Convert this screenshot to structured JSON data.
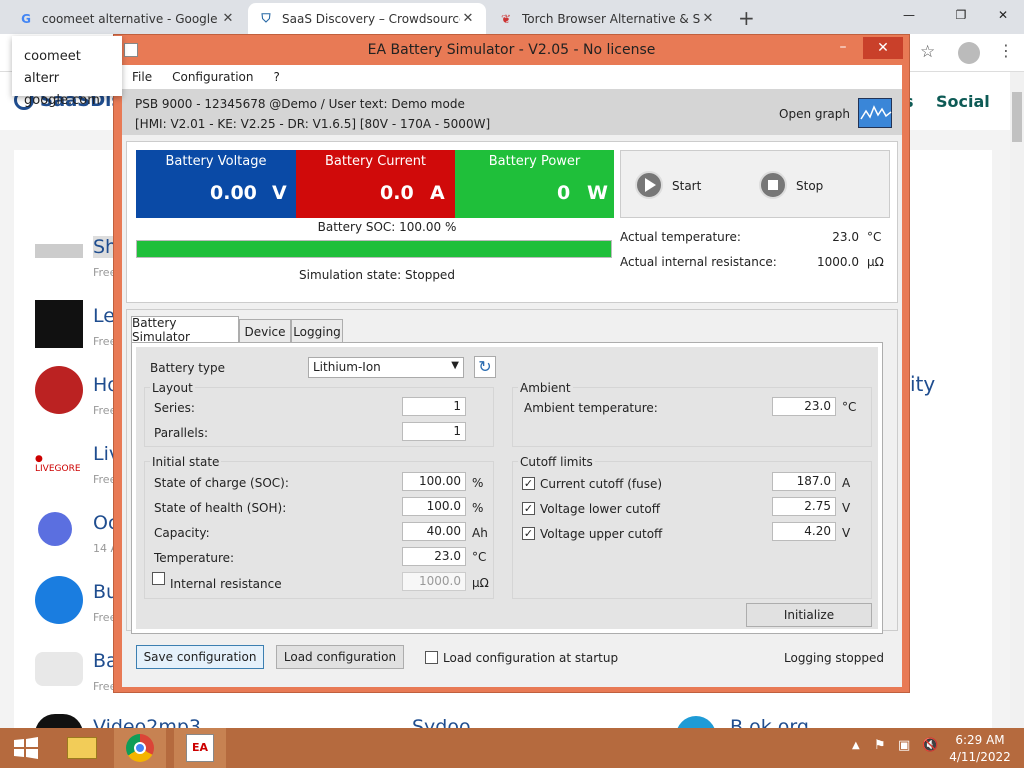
{
  "browser": {
    "tabs": [
      {
        "icon": "google-icon",
        "title": "coomeet alternative - Google Se"
      },
      {
        "icon": "shield-icon",
        "title": "SaaS Discovery – Crowdsourced"
      },
      {
        "icon": "torch-icon",
        "title": "Torch Browser Alternative & Simi"
      }
    ],
    "new_tab": "+",
    "omnibox": {
      "line1": "coomeet alterr",
      "line2": "google.com"
    }
  },
  "website": {
    "logo": "SaaSDisco",
    "nav_social": "Social",
    "nav_s": "s",
    "right_fragment": "ity",
    "items": [
      {
        "name": "Sh",
        "sub": "Free"
      },
      {
        "name": "Le",
        "sub": "Free"
      },
      {
        "name": "Ho",
        "sub": "Free"
      },
      {
        "name": "Liv",
        "sub": "Free"
      },
      {
        "name": "Oc",
        "sub": "14 A"
      },
      {
        "name": "Bu",
        "sub": "Free"
      },
      {
        "name": "Ba",
        "sub": "Free"
      }
    ],
    "bottom": [
      "Video2mp3",
      "Sydoo",
      "B ok.org"
    ]
  },
  "ea": {
    "title": "EA Battery Simulator - V2.05 - No license",
    "menu": [
      "File",
      "Configuration",
      "?"
    ],
    "device_line": "PSB 9000 - 12345678 @Demo / User text: Demo mode",
    "version_line": "[HMI: V2.01 - KE: V2.25 - DR: V1.6.5] [80V - 170A - 5000W]",
    "open_graph": "Open graph",
    "tiles": {
      "voltage": {
        "label": "Battery Voltage",
        "value": "0.00",
        "unit": "V",
        "color": "#0a4aa6"
      },
      "current": {
        "label": "Battery Current",
        "value": "0.0",
        "unit": "A",
        "color": "#d00a0a"
      },
      "power": {
        "label": "Battery Power",
        "value": "0",
        "unit": "W",
        "color": "#1fbf3a"
      }
    },
    "start": "Start",
    "stop": "Stop",
    "soc_label": "Battery SOC: 100.00 %",
    "soc_value": 100,
    "sim_state": "Simulation state: Stopped",
    "actual_temp_label": "Actual temperature:",
    "actual_temp_value": "23.0",
    "actual_temp_unit": "°C",
    "actual_res_label": "Actual internal resistance:",
    "actual_res_value": "1000.0",
    "actual_res_unit": "µΩ",
    "tabs": [
      "Battery Simulator",
      "Device",
      "Logging"
    ],
    "battery_type_label": "Battery type",
    "battery_type_value": "Lithium-Ion",
    "layout": {
      "title": "Layout",
      "series_label": "Series:",
      "series": "1",
      "parallels_label": "Parallels:",
      "parallels": "1"
    },
    "ambient": {
      "title": "Ambient",
      "temp_label": "Ambient temperature:",
      "temp": "23.0",
      "unit": "°C"
    },
    "initial": {
      "title": "Initial state",
      "soc_label": "State of charge (SOC):",
      "soc": "100.00",
      "soc_unit": "%",
      "soh_label": "State of health (SOH):",
      "soh": "100.0",
      "soh_unit": "%",
      "cap_label": "Capacity:",
      "cap": "40.00",
      "cap_unit": "Ah",
      "temp_label": "Temperature:",
      "temp": "23.0",
      "temp_unit": "°C",
      "res_label": "Internal resistance",
      "res": "1000.0",
      "res_unit": "µΩ"
    },
    "cutoff": {
      "title": "Cutoff limits",
      "current_label": "Current cutoff (fuse)",
      "current": "187.0",
      "current_unit": "A",
      "vlow_label": "Voltage lower cutoff",
      "vlow": "2.75",
      "vlow_unit": "V",
      "vhigh_label": "Voltage upper cutoff",
      "vhigh": "4.20",
      "vhigh_unit": "V",
      "check": "✓"
    },
    "initialize": "Initialize",
    "save_config": "Save configuration",
    "load_config": "Load configuration",
    "load_startup": "Load configuration at startup",
    "logging_state": "Logging stopped"
  },
  "taskbar": {
    "time": "6:29 AM",
    "date": "4/11/2022"
  }
}
